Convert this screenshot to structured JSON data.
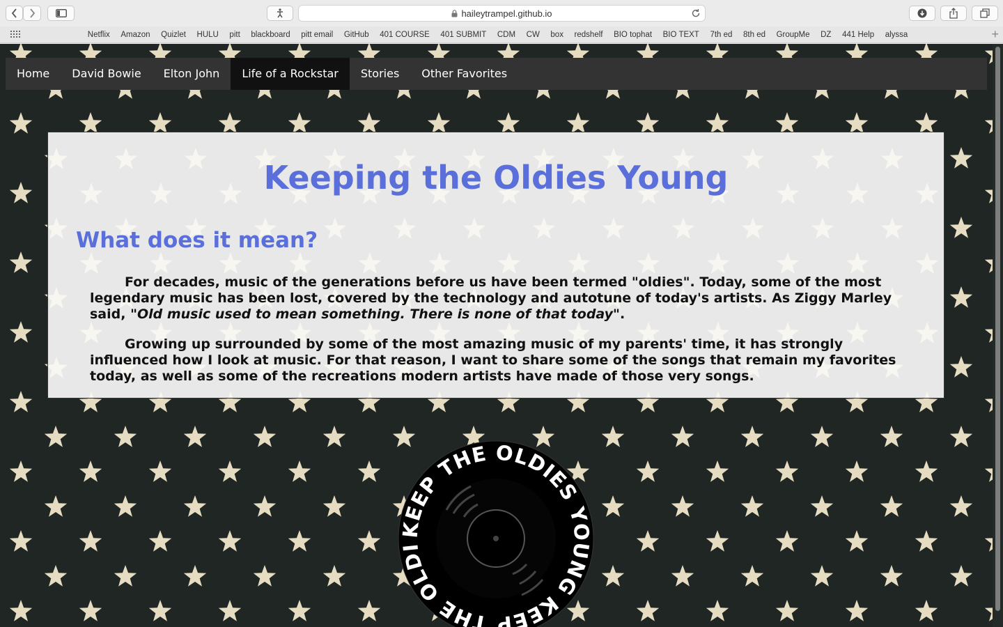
{
  "browser": {
    "url": "haileytrampel.github.io",
    "favorites": [
      "Netflix",
      "Amazon",
      "Quizlet",
      "HULU",
      "pitt",
      "blackboard",
      "pitt email",
      "GitHub",
      "401 COURSE",
      "401 SUBMIT",
      "CDM",
      "CW",
      "box",
      "redshelf",
      "BIO tophat",
      "BIO TEXT",
      "7th ed",
      "8th ed",
      "GroupMe",
      "DZ",
      "441 Help",
      "alyssa"
    ]
  },
  "nav": {
    "items": [
      "Home",
      "David Bowie",
      "Elton John",
      "Life of a Rockstar",
      "Stories",
      "Other Favorites"
    ],
    "active": "Life of a Rockstar"
  },
  "main": {
    "title": "Keeping the Oldies Young",
    "subtitle": "What does it mean?",
    "para1_text": "For decades, music of the generations before us have been termed \"oldies\". Today, some of the most legendary music has been lost, covered by the technology and autotune of today's artists. As Ziggy Marley said, ",
    "para1_quote": "\"Old music used to mean something. There is none of that today\"",
    "para1_end": ".",
    "para2_text": "Growing up surrounded by some of the most amazing music of my parents' time, it has strongly influenced how I look at music. For that reason, I want to share some of the songs that remain my favorites today, as well as some of the recreations modern artists have made of those very songs."
  },
  "logo": {
    "text": "KEEP THE OLDIES YOUNG KEEP THE OLDIES YOUNG"
  },
  "colors": {
    "accent": "#5a6fd9",
    "page_bg": "#202624",
    "star": "#e6dcc2",
    "nav_bg": "#333333",
    "nav_active": "#111111"
  }
}
